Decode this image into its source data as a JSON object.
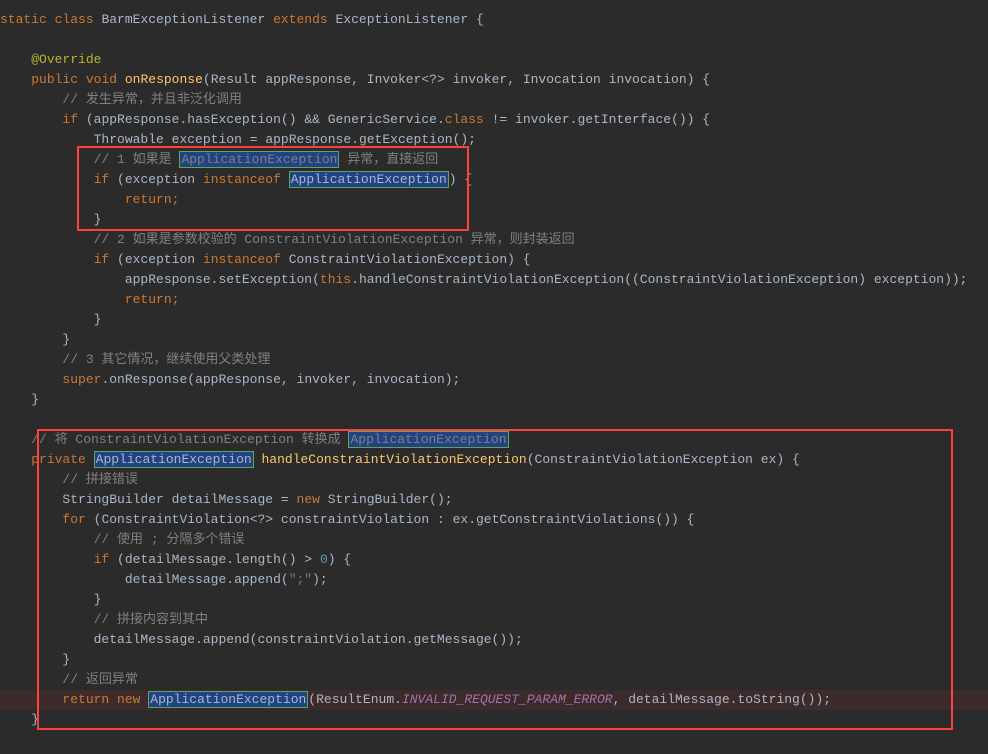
{
  "colors": {
    "bg": "#2b2b2b",
    "text": "#a9b7c6",
    "keyword": "#cc7832",
    "method": "#ffc66d",
    "comment": "#808080",
    "annotation": "#bbb529",
    "string": "#6a8759",
    "number": "#6897bb",
    "highlight_bg": "#214283",
    "highlight_border": "#5fa55a",
    "redbox": "#ff4040"
  },
  "line1": {
    "kw_static": "static",
    "kw_class": "class",
    "type1": "BarmExceptionListener",
    "kw_extends": "extends",
    "type2": "ExceptionListener",
    "brace": "{"
  },
  "line3": {
    "annotation": "@Override"
  },
  "line4": {
    "kw_public": "public",
    "kw_void": "void",
    "method": "onResponse",
    "p1t": "Result",
    "p1n": "appResponse",
    "p2t": "Invoker",
    "p2g": "<?>",
    "p2n": "invoker",
    "p3t": "Invocation",
    "p3n": "invocation",
    "brace": ") {"
  },
  "line5": {
    "comment": "// 发生异常，并且非泛化调用"
  },
  "line6": {
    "kw_if": "if",
    "lp": "(",
    "v1": "appResponse",
    "m1": "hasException",
    "op": "() &&",
    "t1": "GenericService",
    "dot": ".",
    "kw_class": "class",
    "ne": "!=",
    "v2": "invoker",
    "m2": "getInterface",
    "rp": "()) {"
  },
  "line7": {
    "t": "Throwable",
    "v": "exception",
    "eq": "=",
    "v2": "appResponse",
    "m": "getException",
    "end": "();"
  },
  "line8": {
    "c1": "// 1 如果是",
    "hl": "ApplicationException",
    "c2": "异常，直接返回"
  },
  "line9": {
    "kw_if": "if",
    "lp": "(",
    "v": "exception",
    "kw_io": "instanceof",
    "hl": "ApplicationException",
    "rp": ") {"
  },
  "line10": {
    "kw": "return;"
  },
  "line11": {
    "brace": "}"
  },
  "line12": {
    "comment": "// 2 如果是参数校验的 ConstraintViolationException 异常，则封装返回"
  },
  "line13": {
    "kw_if": "if",
    "lp": "(",
    "v": "exception",
    "kw_io": "instanceof",
    "t": "ConstraintViolationException",
    "rp": ") {"
  },
  "line14": {
    "v1": "appResponse",
    "m1": "setException",
    "lp": "(",
    "kw_this": "this",
    "m2": "handleConstraintViolationException",
    "lp2": "((",
    "t": "ConstraintViolationException",
    "rp": ")",
    "v2": "exception",
    "end": "));"
  },
  "line15": {
    "kw": "return;"
  },
  "line16": {
    "brace": "}"
  },
  "line17": {
    "brace": "}"
  },
  "line18": {
    "comment": "// 3 其它情况，继续使用父类处理"
  },
  "line19": {
    "kw_super": "super",
    "m": "onResponse",
    "p1": "appResponse",
    "p2": "invoker",
    "p3": "invocation",
    "end": ");"
  },
  "line20": {
    "brace": "}"
  },
  "line22": {
    "c1": "// 将 ConstraintViolationException 转换成",
    "hl": "ApplicationException"
  },
  "line23": {
    "kw_private": "private",
    "hl": "ApplicationException",
    "method": "handleConstraintViolationException",
    "lp": "(",
    "t": "ConstraintViolationException",
    "p": "ex",
    "rp": ") {"
  },
  "line24": {
    "comment": "// 拼接错误"
  },
  "line25": {
    "t1": "StringBuilder",
    "v": "detailMessage",
    "eq": "=",
    "kw_new": "new",
    "t2": "StringBuilder",
    "end": "();"
  },
  "line26": {
    "kw_for": "for",
    "lp": "(",
    "t": "ConstraintViolation",
    "g": "<?>",
    "v1": "constraintViolation",
    "colon": ":",
    "v2": "ex",
    "m": "getConstraintViolations",
    "rp": "()) {"
  },
  "line27": {
    "comment": "// 使用 ; 分隔多个错误"
  },
  "line28": {
    "kw_if": "if",
    "lp": "(",
    "v": "detailMessage",
    "m": "length",
    "cmp": "() >",
    "num": "0",
    "rp": ") {"
  },
  "line29": {
    "v": "detailMessage",
    "m": "append",
    "lp": "(",
    "str": "\";\"",
    "rp": ");"
  },
  "line30": {
    "brace": "}"
  },
  "line31": {
    "comment": "// 拼接内容到其中"
  },
  "line32": {
    "v1": "detailMessage",
    "m1": "append",
    "lp": "(",
    "v2": "constraintViolation",
    "m2": "getMessage",
    "rp": "());"
  },
  "line33": {
    "brace": "}"
  },
  "line34": {
    "comment": "// 返回异常"
  },
  "line35": {
    "kw_return": "return",
    "kw_new": "new",
    "hl": "ApplicationException",
    "lp": "(",
    "t": "ResultEnum",
    "dot": ".",
    "const": "INVALID_REQUEST_PARAM_ERROR",
    "comma": ",",
    "v": "detailMessage",
    "m": "toString",
    "rp": "());"
  },
  "line36": {
    "brace": "}"
  }
}
